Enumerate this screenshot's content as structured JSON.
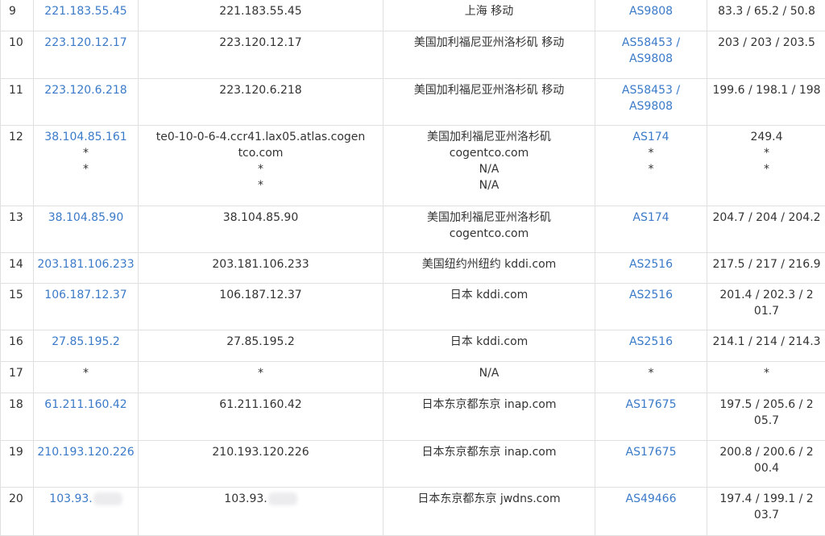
{
  "rows": [
    {
      "hop": "9",
      "ip": [
        "221.183.55.45"
      ],
      "host": [
        "221.183.55.45"
      ],
      "location": [
        "上海 移动"
      ],
      "asn": [
        "AS9808"
      ],
      "rtt": "83.3 / 65.2 / 50.8"
    },
    {
      "hop": "10",
      "ip": [
        "223.120.12.17"
      ],
      "host": [
        "223.120.12.17"
      ],
      "location": [
        "美国加利福尼亚州洛杉矶 移动"
      ],
      "asn": [
        "AS58453 / AS9808"
      ],
      "rtt": "203 / 203 / 203.5"
    },
    {
      "hop": "11",
      "ip": [
        "223.120.6.218"
      ],
      "host": [
        "223.120.6.218"
      ],
      "location": [
        "美国加利福尼亚州洛杉矶 移动"
      ],
      "asn": [
        "AS58453 / AS9808"
      ],
      "rtt": "199.6 / 198.1 / 198"
    },
    {
      "hop": "12",
      "ip": [
        "38.104.85.161",
        "*",
        "*"
      ],
      "host": [
        "te0-10-0-6-4.ccr41.lax05.atlas.cogentco.com",
        "*",
        "*"
      ],
      "location": [
        "美国加利福尼亚州洛杉矶",
        "cogentco.com",
        "N/A",
        "N/A"
      ],
      "asn": [
        "AS174",
        "*",
        "*"
      ],
      "rtt": [
        "249.4",
        "*",
        "*"
      ]
    },
    {
      "hop": "13",
      "ip": [
        "38.104.85.90"
      ],
      "host": [
        "38.104.85.90"
      ],
      "location": [
        "美国加利福尼亚州洛杉矶",
        "cogentco.com"
      ],
      "asn": [
        "AS174"
      ],
      "rtt": "204.7 / 204 / 204.2"
    },
    {
      "hop": "14",
      "ip": [
        "203.181.106.233"
      ],
      "host": [
        "203.181.106.233"
      ],
      "location": [
        "美国纽约州纽约 kddi.com"
      ],
      "asn": [
        "AS2516"
      ],
      "rtt": "217.5 / 217 / 216.9"
    },
    {
      "hop": "15",
      "ip": [
        "106.187.12.37"
      ],
      "host": [
        "106.187.12.37"
      ],
      "location": [
        "日本 kddi.com"
      ],
      "asn": [
        "AS2516"
      ],
      "rtt": "201.4 / 202.3 / 201.7"
    },
    {
      "hop": "16",
      "ip": [
        "27.85.195.2"
      ],
      "host": [
        "27.85.195.2"
      ],
      "location": [
        "日本 kddi.com"
      ],
      "asn": [
        "AS2516"
      ],
      "rtt": "214.1 / 214 / 214.3"
    },
    {
      "hop": "17",
      "ip": [
        "*"
      ],
      "host": [
        "*"
      ],
      "location": [
        "N/A"
      ],
      "asn": [
        "*"
      ],
      "rtt": "*"
    },
    {
      "hop": "18",
      "ip": [
        "61.211.160.42"
      ],
      "host": [
        "61.211.160.42"
      ],
      "location": [
        "日本东京都东京 inap.com"
      ],
      "asn": [
        "AS17675"
      ],
      "rtt": "197.5 / 205.6 / 205.7"
    },
    {
      "hop": "19",
      "ip": [
        "210.193.120.226"
      ],
      "host": [
        "210.193.120.226"
      ],
      "location": [
        "日本东京都东京 inap.com"
      ],
      "asn": [
        "AS17675"
      ],
      "rtt": "200.8 / 200.6 / 200.4"
    },
    {
      "hop": "20",
      "ip": [
        "103.93."
      ],
      "host": [
        "103.93."
      ],
      "location": [
        "日本东京都东京 jwdns.com"
      ],
      "asn": [
        "AS49466"
      ],
      "rtt": "197.4 / 199.1 / 203.7"
    }
  ]
}
